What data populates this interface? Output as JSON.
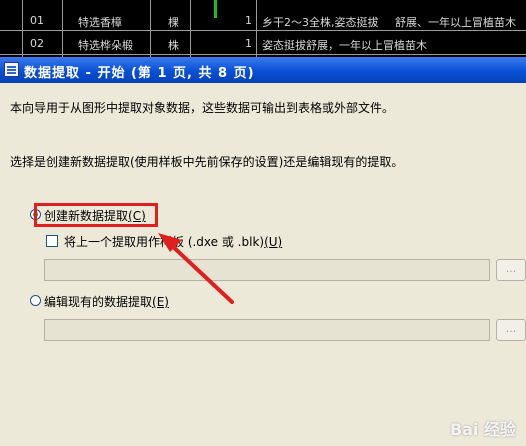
{
  "background_table": {
    "rows": [
      {
        "no": "01",
        "name": "特选香樟",
        "unit": "棵",
        "qty": "1",
        "note": "乡干2～3全株,姿态挺拔",
        "note2": "舒展、一年以上冒植苗木"
      },
      {
        "no": "02",
        "name": "特选桦朵椴",
        "unit": "株",
        "qty": "1",
        "note": "姿态挺拔舒展，一年以上冒植苗木"
      }
    ]
  },
  "dialog": {
    "title": "数据提取 - 开始 (第 1 页, 共 8 页)",
    "description": "本向导用于从图形中提取对象数据，这些数据可输出到表格或外部文件。",
    "prompt": "选择是创建新数据提取(使用样板中先前保存的设置)还是编辑现有的提取。",
    "option_create": {
      "text": "创建新数据提取",
      "key": "(C)",
      "checked": true
    },
    "option_template": {
      "text": "将上一个提取用作样板 (.dxe 或 .blk)",
      "key": "(U)",
      "checked": false
    },
    "template_field_value": "",
    "template_browse": "...",
    "option_edit": {
      "text": "编辑现有的数据提取",
      "key": "(E)",
      "checked": false
    },
    "edit_field_value": "",
    "edit_browse": "..."
  },
  "watermark": "Bai 经验",
  "colors": {
    "titlebar": "#0a4fd4",
    "highlight": "#e02020",
    "dialog_bg": "#ece9d8"
  }
}
